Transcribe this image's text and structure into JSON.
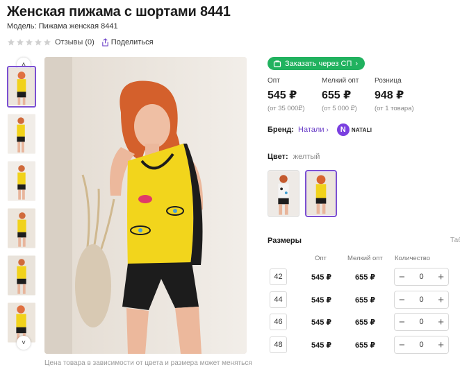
{
  "product": {
    "title": "Женская пижама с шортами 8441",
    "model": "Модель: Пижама женская 8441",
    "reviews": "Отзывы (0)",
    "share": "Поделиться",
    "rating_stars": 0
  },
  "order_button": {
    "label": "Заказать через СП",
    "color": "#21b25f"
  },
  "prices": [
    {
      "label": "Опт",
      "value": "545 ₽",
      "sub": "(от 35 000₽)"
    },
    {
      "label": "Мелкий опт",
      "value": "655 ₽",
      "sub": "(от 5 000 ₽)"
    },
    {
      "label": "Розница",
      "value": "948 ₽",
      "sub": "(от 1 товара)"
    }
  ],
  "brand": {
    "label": "Бренд:",
    "name": "Натали",
    "logo_letter": "N",
    "logo_text": "NATALI",
    "accent": "#7a3fe0"
  },
  "color": {
    "label": "Цвет:",
    "value": "желтый"
  },
  "sizes": {
    "title": "Размеры",
    "table_link": "Таб",
    "headers": {
      "opt": "Опт",
      "small_opt": "Мелкий опт",
      "qty": "Количество"
    },
    "rows": [
      {
        "size": "42",
        "opt": "545 ₽",
        "small_opt": "655 ₽",
        "qty": "0"
      },
      {
        "size": "44",
        "opt": "545 ₽",
        "small_opt": "655 ₽",
        "qty": "0"
      },
      {
        "size": "46",
        "opt": "545 ₽",
        "small_opt": "655 ₽",
        "qty": "0"
      },
      {
        "size": "48",
        "opt": "545 ₽",
        "small_opt": "655 ₽",
        "qty": "0"
      }
    ],
    "minus": "−",
    "plus": "+"
  },
  "note": "Цена товара в зависимости от цвета и размера может меняться",
  "thumbnails": {
    "count": 6,
    "active_index": 0,
    "up_icon": "chevron-up-icon",
    "down_icon": "chevron-down-icon"
  },
  "accent_color": "#7b4fd2"
}
